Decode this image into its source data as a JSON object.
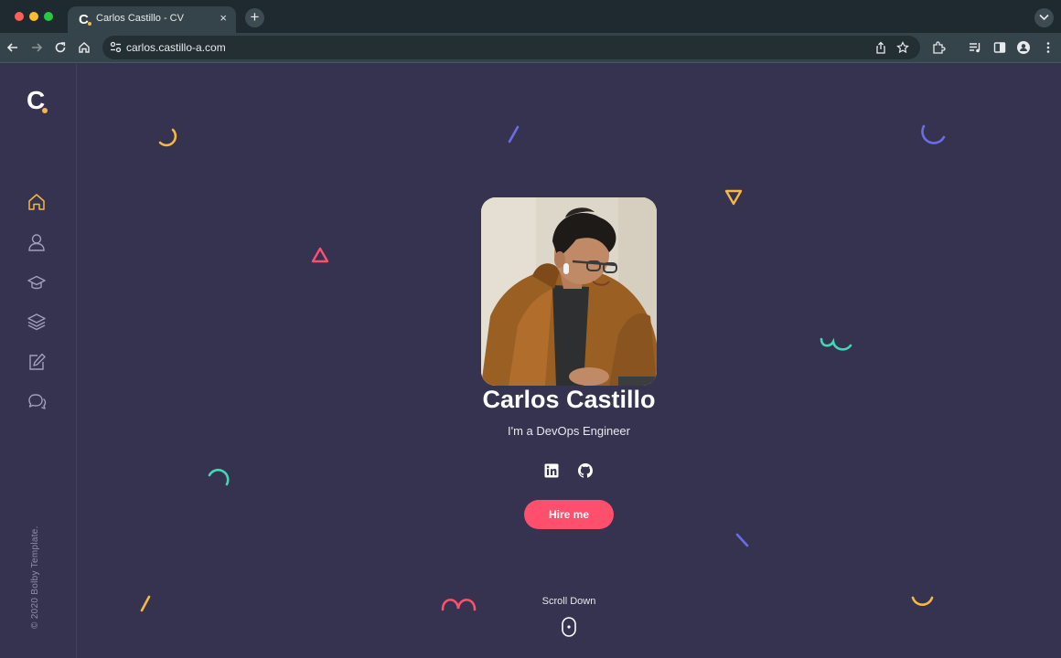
{
  "browser": {
    "tab_title": "Carlos Castillo - CV",
    "tab_favicon_letter": "C",
    "tab_close": "×",
    "new_tab": "+",
    "url": "carlos.castillo-a.com"
  },
  "sidebar": {
    "logo": "C",
    "nav": [
      {
        "icon": "home-icon",
        "active": true
      },
      {
        "icon": "user-icon",
        "active": false
      },
      {
        "icon": "graduation-cap-icon",
        "active": false
      },
      {
        "icon": "layers-icon",
        "active": false
      },
      {
        "icon": "edit-icon",
        "active": false
      },
      {
        "icon": "chat-icon",
        "active": false
      }
    ],
    "copyright": "© 2020 Bolby Template."
  },
  "hero": {
    "name": "Carlos Castillo",
    "subtitle": "I'm a DevOps Engineer",
    "social": [
      "linkedin-icon",
      "github-icon"
    ],
    "hire_label": "Hire me",
    "scroll_label": "Scroll Down"
  },
  "colors": {
    "background": "#35334f",
    "accent_red": "#fe4f6c",
    "accent_yellow": "#f6b845",
    "accent_purple": "#6c6ce5",
    "accent_teal": "#44d7b6"
  }
}
